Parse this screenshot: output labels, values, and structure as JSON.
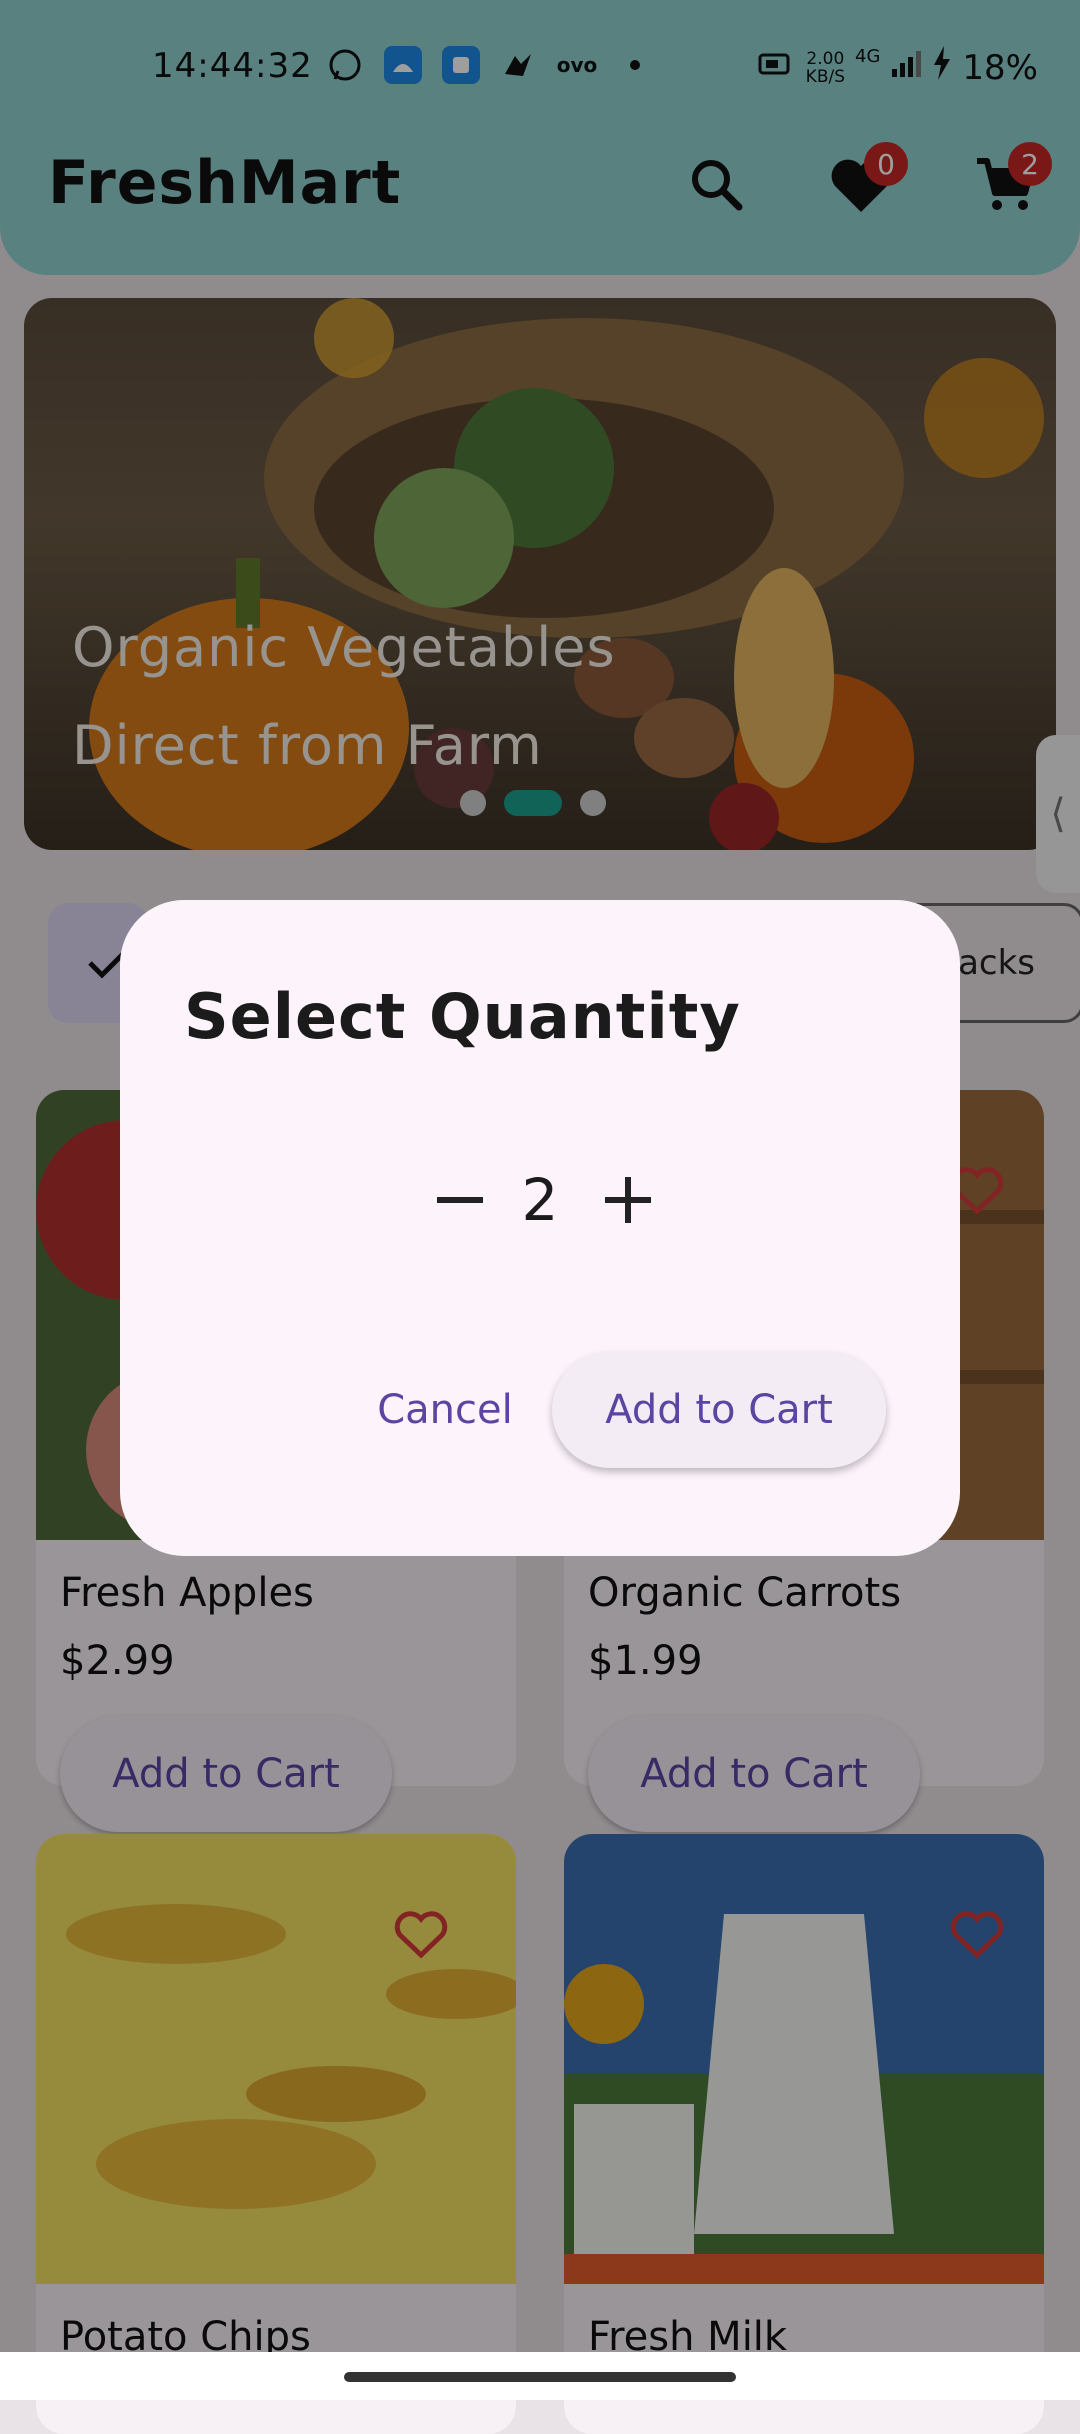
{
  "status": {
    "time": "14:44:32",
    "net_speed": "2.00",
    "net_unit": "KB/S",
    "net_type": "4G",
    "battery": "18%",
    "icons": [
      "whatsapp-icon",
      "android-icon",
      "app-icon",
      "lightning-app-icon",
      "ovo-icon",
      "dot-icon"
    ]
  },
  "appbar": {
    "title": "FreshMart",
    "wishlist_count": "0",
    "cart_count": "2"
  },
  "banner": {
    "line1": "Organic Vegetables",
    "line2": "Direct from Farm"
  },
  "chips": {
    "right_partial": "nacks"
  },
  "products": [
    {
      "name": "Fresh Apples",
      "price": "$2.99",
      "button": "Add to Cart"
    },
    {
      "name": "Organic Carrots",
      "price": "$1.99",
      "button": "Add to Cart"
    },
    {
      "name": "Potato Chips",
      "price": ""
    },
    {
      "name": "Fresh Milk",
      "price": ""
    }
  ],
  "dialog": {
    "title": "Select Quantity",
    "quantity": "2",
    "cancel": "Cancel",
    "confirm": "Add to Cart"
  },
  "colors": {
    "appbar": "#8fd1cf",
    "accent_text": "#5b45a3",
    "badge": "#c62828",
    "dot_active": "#1aa08b"
  }
}
